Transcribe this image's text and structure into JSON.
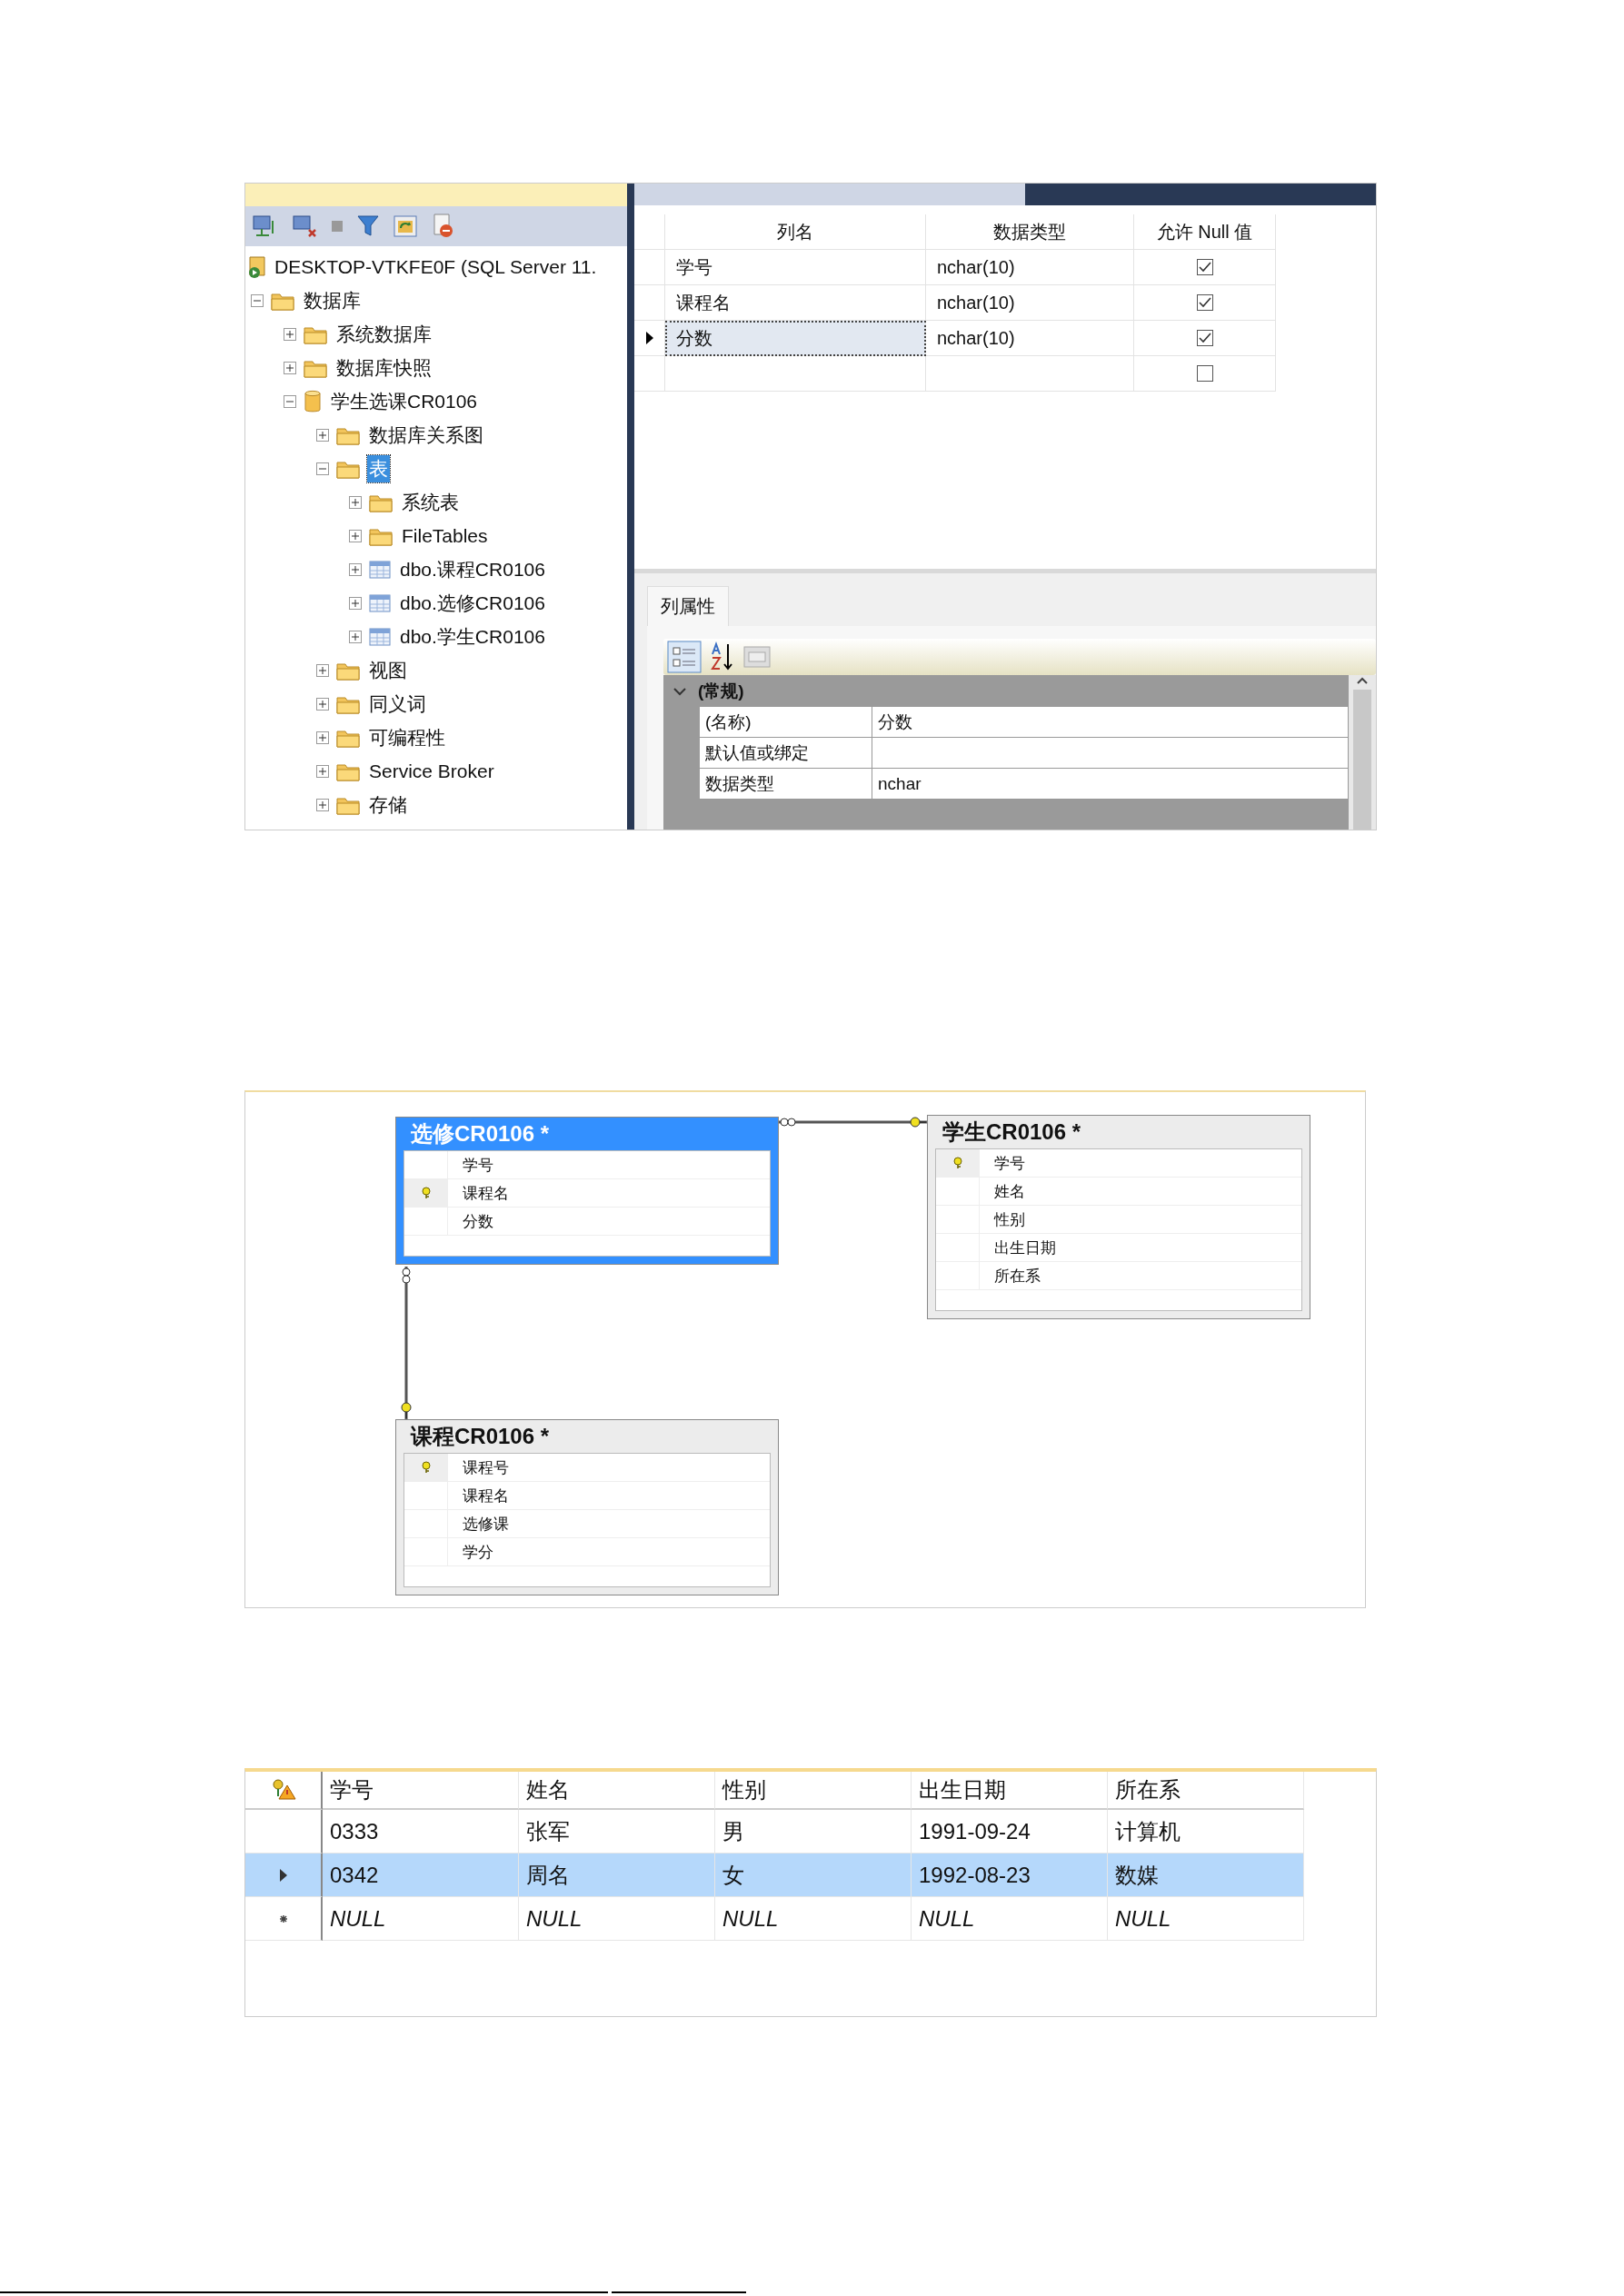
{
  "object_explorer": {
    "server": "DESKTOP-VTKFE0F (SQL Server 11.",
    "tree": [
      {
        "label": "数据库",
        "kind": "folder",
        "expanded": true,
        "selected": false,
        "children": [
          {
            "label": "系统数据库",
            "kind": "folder",
            "expanded": false,
            "selected": false
          },
          {
            "label": "数据库快照",
            "kind": "folder",
            "expanded": false,
            "selected": false
          },
          {
            "label": "学生选课CR0106",
            "kind": "database",
            "expanded": true,
            "selected": false,
            "children": [
              {
                "label": "数据库关系图",
                "kind": "folder",
                "expanded": false,
                "selected": false
              },
              {
                "label": "表",
                "kind": "folder",
                "expanded": true,
                "selected": true,
                "children": [
                  {
                    "label": "系统表",
                    "kind": "folder",
                    "expanded": false,
                    "selected": false
                  },
                  {
                    "label": "FileTables",
                    "kind": "folder",
                    "expanded": false,
                    "selected": false
                  },
                  {
                    "label": "dbo.课程CR0106",
                    "kind": "table",
                    "expanded": false,
                    "selected": false
                  },
                  {
                    "label": "dbo.选修CR0106",
                    "kind": "table",
                    "expanded": false,
                    "selected": false
                  },
                  {
                    "label": "dbo.学生CR0106",
                    "kind": "table",
                    "expanded": false,
                    "selected": false
                  }
                ]
              },
              {
                "label": "视图",
                "kind": "folder",
                "expanded": false,
                "selected": false
              },
              {
                "label": "同义词",
                "kind": "folder",
                "expanded": false,
                "selected": false
              },
              {
                "label": "可编程性",
                "kind": "folder",
                "expanded": false,
                "selected": false
              },
              {
                "label": "Service Broker",
                "kind": "folder",
                "expanded": false,
                "selected": false
              },
              {
                "label": "存储",
                "kind": "folder",
                "expanded": false,
                "selected": false
              }
            ]
          }
        ]
      }
    ]
  },
  "table_designer": {
    "columns": [
      "列名",
      "数据类型",
      "允许 Null 值"
    ],
    "rows": [
      {
        "name": "学号",
        "type": "nchar(10)",
        "allow_null": true,
        "selected": false
      },
      {
        "name": "课程名",
        "type": "nchar(10)",
        "allow_null": true,
        "selected": false
      },
      {
        "name": "分数",
        "type": "nchar(10)",
        "allow_null": true,
        "selected": true
      },
      {
        "allow_null": false,
        "selected": false
      }
    ]
  },
  "column_properties": {
    "tab": "列属性",
    "category": "(常规)",
    "rows": [
      {
        "name": "(名称)",
        "value": "分数"
      },
      {
        "name": "默认值或绑定"
      },
      {
        "name": "数据类型",
        "value": "nchar"
      }
    ]
  },
  "diagram": {
    "tables": [
      {
        "title": "选修CR0106 *",
        "selected": true,
        "columns": [
          {
            "name": "学号",
            "key": false
          },
          {
            "name": "课程名",
            "key": true
          },
          {
            "name": "分数",
            "key": false
          }
        ]
      },
      {
        "title": "学生CR0106 *",
        "selected": false,
        "columns": [
          {
            "name": "学号",
            "key": true
          },
          {
            "name": "姓名",
            "key": false
          },
          {
            "name": "性别",
            "key": false
          },
          {
            "name": "出生日期",
            "key": false
          },
          {
            "name": "所在系",
            "key": false
          }
        ]
      },
      {
        "title": "课程CR0106 *",
        "selected": false,
        "columns": [
          {
            "name": "课程号",
            "key": true
          },
          {
            "name": "课程名",
            "key": false
          },
          {
            "name": "选修课",
            "key": false
          },
          {
            "name": "学分",
            "key": false
          }
        ]
      }
    ]
  },
  "results": {
    "columns": [
      "学号",
      "姓名",
      "性别",
      "出生日期",
      "所在系"
    ],
    "rows": [
      {
        "kind": "data",
        "selected": false,
        "cells": [
          "0333",
          "张军",
          "男",
          "1991-09-24",
          "计算机"
        ]
      },
      {
        "kind": "data",
        "selected": true,
        "cells": [
          "0342",
          "周名",
          "女",
          "1992-08-23",
          "数媒"
        ]
      },
      {
        "kind": "new",
        "selected": false,
        "cells": [
          "NULL",
          "NULL",
          "NULL",
          "NULL",
          "NULL"
        ]
      }
    ]
  }
}
